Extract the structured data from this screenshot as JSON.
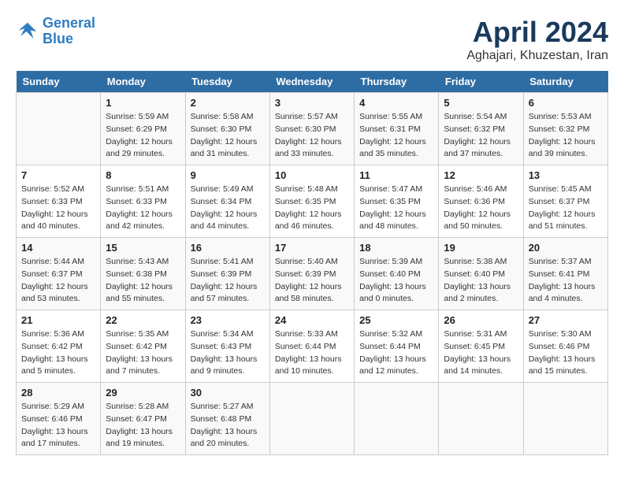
{
  "header": {
    "logo_line1": "General",
    "logo_line2": "Blue",
    "title": "April 2024",
    "subtitle": "Aghajari, Khuzestan, Iran"
  },
  "weekdays": [
    "Sunday",
    "Monday",
    "Tuesday",
    "Wednesday",
    "Thursday",
    "Friday",
    "Saturday"
  ],
  "weeks": [
    [
      {
        "day": "",
        "info": ""
      },
      {
        "day": "1",
        "info": "Sunrise: 5:59 AM\nSunset: 6:29 PM\nDaylight: 12 hours\nand 29 minutes."
      },
      {
        "day": "2",
        "info": "Sunrise: 5:58 AM\nSunset: 6:30 PM\nDaylight: 12 hours\nand 31 minutes."
      },
      {
        "day": "3",
        "info": "Sunrise: 5:57 AM\nSunset: 6:30 PM\nDaylight: 12 hours\nand 33 minutes."
      },
      {
        "day": "4",
        "info": "Sunrise: 5:55 AM\nSunset: 6:31 PM\nDaylight: 12 hours\nand 35 minutes."
      },
      {
        "day": "5",
        "info": "Sunrise: 5:54 AM\nSunset: 6:32 PM\nDaylight: 12 hours\nand 37 minutes."
      },
      {
        "day": "6",
        "info": "Sunrise: 5:53 AM\nSunset: 6:32 PM\nDaylight: 12 hours\nand 39 minutes."
      }
    ],
    [
      {
        "day": "7",
        "info": "Sunrise: 5:52 AM\nSunset: 6:33 PM\nDaylight: 12 hours\nand 40 minutes."
      },
      {
        "day": "8",
        "info": "Sunrise: 5:51 AM\nSunset: 6:33 PM\nDaylight: 12 hours\nand 42 minutes."
      },
      {
        "day": "9",
        "info": "Sunrise: 5:49 AM\nSunset: 6:34 PM\nDaylight: 12 hours\nand 44 minutes."
      },
      {
        "day": "10",
        "info": "Sunrise: 5:48 AM\nSunset: 6:35 PM\nDaylight: 12 hours\nand 46 minutes."
      },
      {
        "day": "11",
        "info": "Sunrise: 5:47 AM\nSunset: 6:35 PM\nDaylight: 12 hours\nand 48 minutes."
      },
      {
        "day": "12",
        "info": "Sunrise: 5:46 AM\nSunset: 6:36 PM\nDaylight: 12 hours\nand 50 minutes."
      },
      {
        "day": "13",
        "info": "Sunrise: 5:45 AM\nSunset: 6:37 PM\nDaylight: 12 hours\nand 51 minutes."
      }
    ],
    [
      {
        "day": "14",
        "info": "Sunrise: 5:44 AM\nSunset: 6:37 PM\nDaylight: 12 hours\nand 53 minutes."
      },
      {
        "day": "15",
        "info": "Sunrise: 5:43 AM\nSunset: 6:38 PM\nDaylight: 12 hours\nand 55 minutes."
      },
      {
        "day": "16",
        "info": "Sunrise: 5:41 AM\nSunset: 6:39 PM\nDaylight: 12 hours\nand 57 minutes."
      },
      {
        "day": "17",
        "info": "Sunrise: 5:40 AM\nSunset: 6:39 PM\nDaylight: 12 hours\nand 58 minutes."
      },
      {
        "day": "18",
        "info": "Sunrise: 5:39 AM\nSunset: 6:40 PM\nDaylight: 13 hours\nand 0 minutes."
      },
      {
        "day": "19",
        "info": "Sunrise: 5:38 AM\nSunset: 6:40 PM\nDaylight: 13 hours\nand 2 minutes."
      },
      {
        "day": "20",
        "info": "Sunrise: 5:37 AM\nSunset: 6:41 PM\nDaylight: 13 hours\nand 4 minutes."
      }
    ],
    [
      {
        "day": "21",
        "info": "Sunrise: 5:36 AM\nSunset: 6:42 PM\nDaylight: 13 hours\nand 5 minutes."
      },
      {
        "day": "22",
        "info": "Sunrise: 5:35 AM\nSunset: 6:42 PM\nDaylight: 13 hours\nand 7 minutes."
      },
      {
        "day": "23",
        "info": "Sunrise: 5:34 AM\nSunset: 6:43 PM\nDaylight: 13 hours\nand 9 minutes."
      },
      {
        "day": "24",
        "info": "Sunrise: 5:33 AM\nSunset: 6:44 PM\nDaylight: 13 hours\nand 10 minutes."
      },
      {
        "day": "25",
        "info": "Sunrise: 5:32 AM\nSunset: 6:44 PM\nDaylight: 13 hours\nand 12 minutes."
      },
      {
        "day": "26",
        "info": "Sunrise: 5:31 AM\nSunset: 6:45 PM\nDaylight: 13 hours\nand 14 minutes."
      },
      {
        "day": "27",
        "info": "Sunrise: 5:30 AM\nSunset: 6:46 PM\nDaylight: 13 hours\nand 15 minutes."
      }
    ],
    [
      {
        "day": "28",
        "info": "Sunrise: 5:29 AM\nSunset: 6:46 PM\nDaylight: 13 hours\nand 17 minutes."
      },
      {
        "day": "29",
        "info": "Sunrise: 5:28 AM\nSunset: 6:47 PM\nDaylight: 13 hours\nand 19 minutes."
      },
      {
        "day": "30",
        "info": "Sunrise: 5:27 AM\nSunset: 6:48 PM\nDaylight: 13 hours\nand 20 minutes."
      },
      {
        "day": "",
        "info": ""
      },
      {
        "day": "",
        "info": ""
      },
      {
        "day": "",
        "info": ""
      },
      {
        "day": "",
        "info": ""
      }
    ]
  ]
}
